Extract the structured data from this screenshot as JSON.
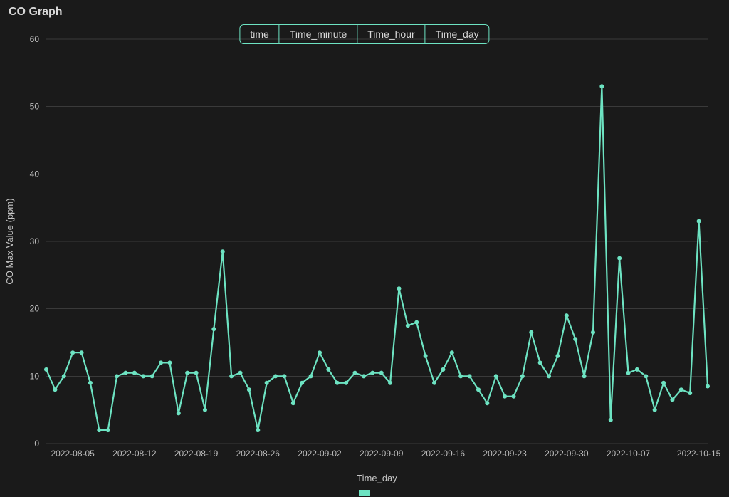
{
  "header": {
    "title": "CO Graph"
  },
  "controls": {
    "segments": [
      "time",
      "Time_minute",
      "Time_hour",
      "Time_day"
    ]
  },
  "chart_data": {
    "type": "line",
    "title": "",
    "xlabel": "Time_day",
    "ylabel": "CO Max Value (ppm)",
    "ylim": [
      0,
      60
    ],
    "yticks": [
      0,
      10,
      20,
      30,
      40,
      50,
      60
    ],
    "xticks": [
      "2022-08-05",
      "2022-08-12",
      "2022-08-19",
      "2022-08-26",
      "2022-09-02",
      "2022-09-09",
      "2022-09-16",
      "2022-09-23",
      "2022-09-30",
      "2022-10-07",
      "2022-10-15"
    ],
    "categories": [
      "2022-08-02",
      "2022-08-03",
      "2022-08-04",
      "2022-08-05",
      "2022-08-06",
      "2022-08-07",
      "2022-08-08",
      "2022-08-09",
      "2022-08-10",
      "2022-08-11",
      "2022-08-12",
      "2022-08-13",
      "2022-08-14",
      "2022-08-15",
      "2022-08-16",
      "2022-08-17",
      "2022-08-18",
      "2022-08-19",
      "2022-08-20",
      "2022-08-21",
      "2022-08-22",
      "2022-08-23",
      "2022-08-24",
      "2022-08-25",
      "2022-08-26",
      "2022-08-27",
      "2022-08-28",
      "2022-08-29",
      "2022-08-30",
      "2022-08-31",
      "2022-09-01",
      "2022-09-02",
      "2022-09-03",
      "2022-09-04",
      "2022-09-05",
      "2022-09-06",
      "2022-09-07",
      "2022-09-08",
      "2022-09-09",
      "2022-09-10",
      "2022-09-11",
      "2022-09-12",
      "2022-09-13",
      "2022-09-14",
      "2022-09-15",
      "2022-09-16",
      "2022-09-17",
      "2022-09-18",
      "2022-09-19",
      "2022-09-20",
      "2022-09-21",
      "2022-09-22",
      "2022-09-23",
      "2022-09-24",
      "2022-09-25",
      "2022-09-26",
      "2022-09-27",
      "2022-09-28",
      "2022-09-29",
      "2022-09-30",
      "2022-10-01",
      "2022-10-02",
      "2022-10-03",
      "2022-10-04",
      "2022-10-05",
      "2022-10-06",
      "2022-10-07",
      "2022-10-08",
      "2022-10-09",
      "2022-10-10",
      "2022-10-11",
      "2022-10-12",
      "2022-10-13",
      "2022-10-14",
      "2022-10-15",
      "2022-10-16"
    ],
    "series": [
      {
        "name": "CO Max",
        "color": "#6de3c2",
        "values": [
          11,
          8,
          10,
          13.5,
          13.5,
          9,
          2,
          2,
          10,
          10.5,
          10.5,
          10,
          10,
          12,
          12,
          4.5,
          10.5,
          10.5,
          5,
          17,
          28.5,
          10,
          10.5,
          8,
          2,
          9,
          10,
          10,
          6,
          9,
          10,
          13.5,
          11,
          9,
          9,
          10.5,
          10,
          10.5,
          10.5,
          9,
          23,
          17.5,
          18,
          13,
          9,
          11,
          13.5,
          10,
          10,
          8,
          6,
          10,
          7,
          7,
          10,
          16.5,
          12,
          10,
          13,
          19,
          15.5,
          10,
          16.5,
          53,
          3.5,
          27.5,
          10.5,
          11,
          10,
          5,
          9,
          6.5,
          8,
          7.5,
          33,
          8.5
        ]
      }
    ]
  }
}
